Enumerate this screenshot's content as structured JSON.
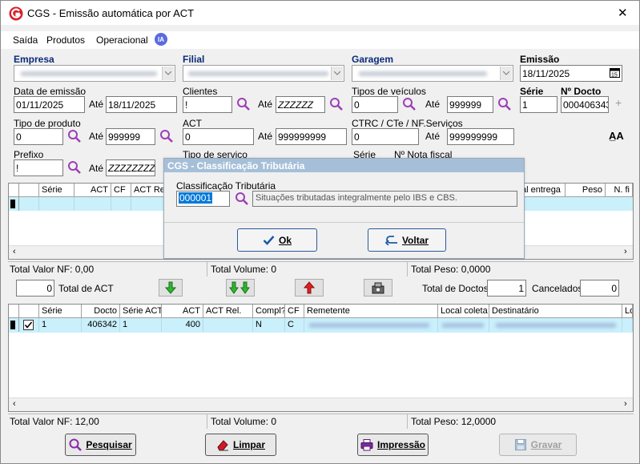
{
  "window": {
    "title": "CGS - Emissão automática por ACT",
    "close_glyph": "✕"
  },
  "menu": {
    "items": [
      "Saída",
      "Produtos",
      "Operacional"
    ],
    "ia_badge": "IA"
  },
  "filters": {
    "empresa_label": "Empresa",
    "filial_label": "Filial",
    "garagem_label": "Garagem",
    "emissao_label": "Emissão",
    "emissao_value": "18/11/2025",
    "data_emissao_label": "Data de emissão",
    "data_emissao_from": "01/11/2025",
    "ate": "Até",
    "data_emissao_to": "18/11/2025",
    "clientes_label": "Clientes",
    "clientes_from": "!",
    "clientes_to": "ZZZZZZ",
    "tipos_veiculos_label": "Tipos de veículos",
    "tipos_veiculos_from": "0",
    "tipos_veiculos_to": "999999",
    "serie_label": "Série",
    "serie_value": "1",
    "nr_docto_label": "Nº Docto",
    "nr_docto_value": "000406343",
    "tipo_produto_label": "Tipo de produto",
    "tipo_produto_from": "0",
    "tipo_produto_to": "999999",
    "act_label": "ACT",
    "act_from": "0",
    "act_to": "999999999",
    "ctrc_label": "CTRC / CTe / NF.Serviços",
    "ctrc_from": "0",
    "ctrc_to": "999999999",
    "prefixo_label": "Prefixo",
    "prefixo_from": "!",
    "prefixo_to": "ZZZZZZZZ",
    "tipo_servico_label": "Tipo de serviço",
    "serie_nf_label": "Série",
    "nr_nota_fiscal_label": "Nº Nota fiscal",
    "font_icon": "A̲A"
  },
  "dialog": {
    "title": "CGS - Classificação Tributária",
    "field_label": "Classificação Tributária",
    "code": "000001",
    "description": "Situações tributadas integralmente pelo IBS e CBS.",
    "ok_label": "Ok",
    "voltar_label": "Voltar"
  },
  "grid1": {
    "columns": [
      "Série",
      "ACT",
      "CF",
      "ACT Rel.",
      "al entrega",
      "Peso",
      "N. fi"
    ]
  },
  "totals1": {
    "valor_nf": "Total Valor NF:  0,00",
    "volume": "Total Volume:  0",
    "peso": "Total Peso:  0,0000"
  },
  "actions": {
    "act_count": "0",
    "total_act_label": "Total de ACT",
    "total_doctos_label": "Total de Doctos",
    "total_doctos": "1",
    "cancelados_label": "Cancelados",
    "cancelados": "0"
  },
  "grid2": {
    "columns": [
      "Série",
      "Docto",
      "Série ACT",
      "ACT",
      "ACT Rel.",
      "Compl?",
      "CF",
      "Remetente",
      "Local coleta",
      "Destinatário",
      "Lo"
    ],
    "row": {
      "serie": "1",
      "docto": "406342",
      "serie_act": "1",
      "act": "400",
      "act_rel": "",
      "compl": "N",
      "cf": "C"
    }
  },
  "totals2": {
    "valor_nf": "Total Valor NF:  12,00",
    "volume": "Total Volume:  0",
    "peso": "Total Peso:  12,0000"
  },
  "buttons": {
    "pesquisar": "Pesquisar",
    "limpar": "Limpar",
    "impressao": "Impressão",
    "gravar": "Gravar"
  },
  "colors": {
    "accent_blue": "#0a2a78",
    "dialog_title": "#a6bfd9",
    "row_cyan": "#c9f0fb",
    "selected_blue": "#0078d7"
  }
}
